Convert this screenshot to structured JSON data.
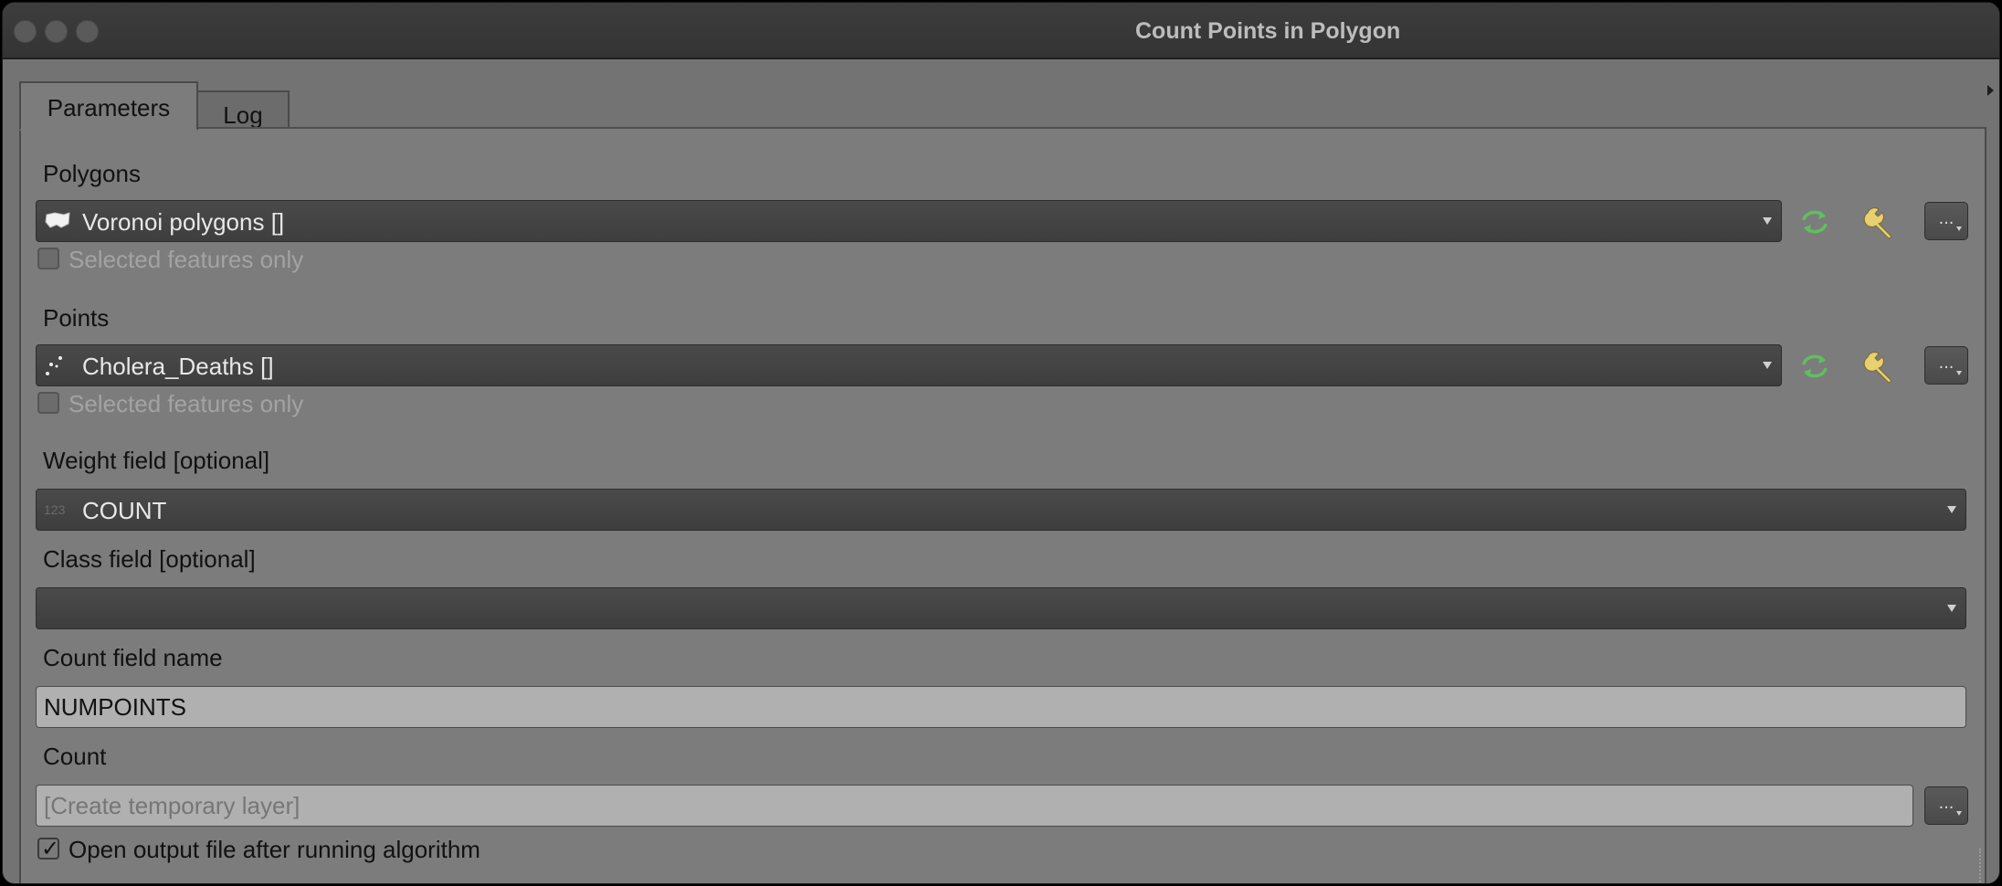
{
  "window": {
    "title": "Count Points in Polygon"
  },
  "tabs": [
    {
      "label": "Parameters"
    },
    {
      "label": "Log"
    }
  ],
  "params": {
    "polygons": {
      "label": "Polygons",
      "value": "Voronoi polygons []",
      "selected_only_label": "Selected features only"
    },
    "points": {
      "label": "Points",
      "value": "Cholera_Deaths []",
      "selected_only_label": "Selected features only"
    },
    "weight_field": {
      "label": "Weight field [optional]",
      "type_badge": "123",
      "value": "COUNT"
    },
    "class_field": {
      "label": "Class field [optional]",
      "value": ""
    },
    "count_field_name": {
      "label": "Count field name",
      "value": "NUMPOINTS"
    },
    "count": {
      "label": "Count",
      "placeholder": "[Create temporary layer]"
    },
    "open_output": {
      "label": "Open output file after running algorithm",
      "checked": true
    }
  },
  "buttons": {
    "more_label": "..."
  },
  "colors": {
    "iterate_icon": "#5fbf5f",
    "wrench_icon": "#e8d070"
  }
}
